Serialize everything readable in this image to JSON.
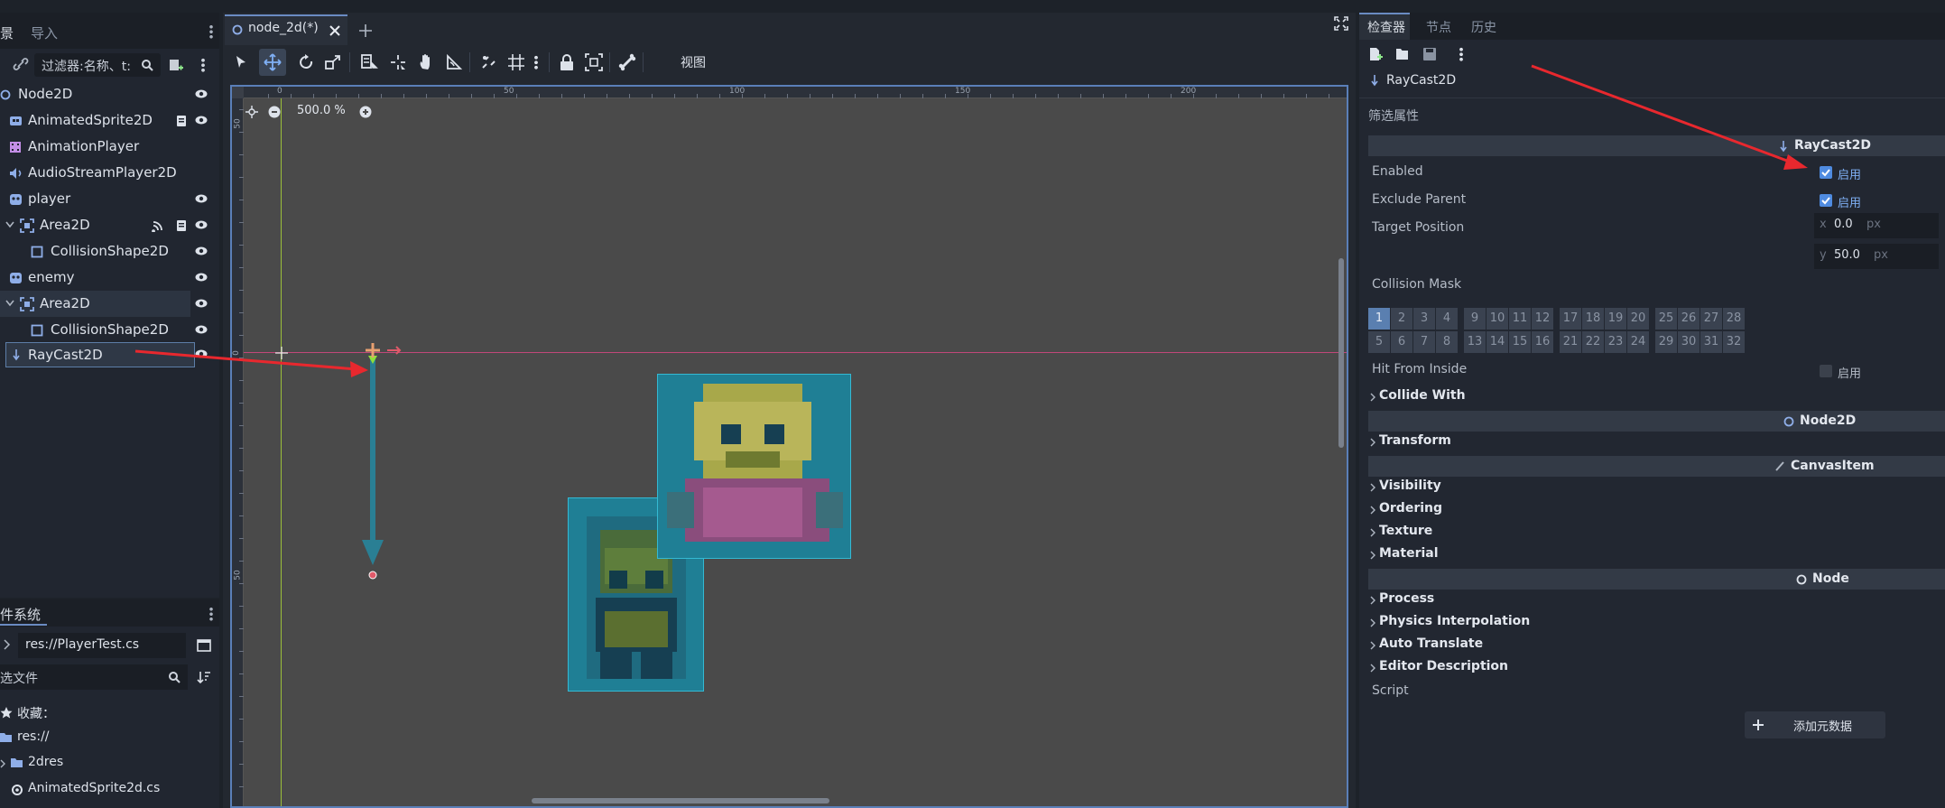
{
  "scene_dock": {
    "tabs": [
      "景",
      "导入"
    ],
    "filter_placeholder": "过滤器:名称、t:",
    "nodes": [
      {
        "label": "Node2D"
      },
      {
        "label": "AnimatedSprite2D"
      },
      {
        "label": "AnimationPlayer"
      },
      {
        "label": "AudioStreamPlayer2D"
      },
      {
        "label": "player"
      },
      {
        "label": "Area2D"
      },
      {
        "label": "CollisionShape2D"
      },
      {
        "label": "enemy"
      },
      {
        "label": "Area2D"
      },
      {
        "label": "CollisionShape2D"
      },
      {
        "label": "RayCast2D"
      }
    ]
  },
  "filesystem_dock": {
    "tab": "件系统",
    "path": "res://PlayerTest.cs",
    "filter_placeholder": "选文件",
    "favorites_label": "收藏：",
    "items": [
      "res://",
      "2dres",
      "AnimatedSprite2d.cs"
    ]
  },
  "editor": {
    "tab_label": "node_2d(*)",
    "view_menu": "视图",
    "zoom": "500.0 %",
    "ruler_ticks": [
      "0",
      "50",
      "100",
      "150",
      "200"
    ],
    "vertical_ticks": [
      "50",
      "0",
      "50"
    ]
  },
  "inspector": {
    "tabs": [
      "检查器",
      "节点",
      "历史"
    ],
    "object_name": "RayCast2D",
    "filter_label": "筛选属性",
    "class_header": "RayCast2D",
    "properties": {
      "enabled": {
        "label": "Enabled",
        "value": "启用",
        "checked": true
      },
      "exclude_parent": {
        "label": "Exclude Parent",
        "value": "启用",
        "checked": true
      },
      "target_position": {
        "label": "Target Position",
        "x_label": "x",
        "x": "0.0",
        "y_label": "y",
        "y": "50.0",
        "unit": "px"
      },
      "collision_mask": {
        "label": "Collision Mask",
        "row1": [
          "1",
          "2",
          "3",
          "4",
          "9",
          "10",
          "11",
          "12",
          "17",
          "18",
          "19",
          "20",
          "25",
          "26",
          "27",
          "28"
        ],
        "row2": [
          "5",
          "6",
          "7",
          "8",
          "13",
          "14",
          "15",
          "16",
          "21",
          "22",
          "23",
          "24",
          "29",
          "30",
          "31",
          "32"
        ],
        "active": "1"
      },
      "hit_from_inside": {
        "label": "Hit From Inside",
        "value": "启用",
        "checked": false
      }
    },
    "sections": {
      "collide_with": "Collide With",
      "node2d_header": "Node2D",
      "transform": "Transform",
      "canvasitem_header": "CanvasItem",
      "visibility": "Visibility",
      "ordering": "Ordering",
      "texture": "Texture",
      "material": "Material",
      "node_header": "Node",
      "process": "Process",
      "physics_interpolation": "Physics Interpolation",
      "auto_translate": "Auto Translate",
      "editor_description": "Editor Description"
    },
    "script_label": "Script",
    "add_metadata": "添加元数据"
  },
  "colors": {
    "accent": "#4f8be0",
    "annotation": "#e8282e",
    "sprite_box": "#1f8fa8"
  }
}
